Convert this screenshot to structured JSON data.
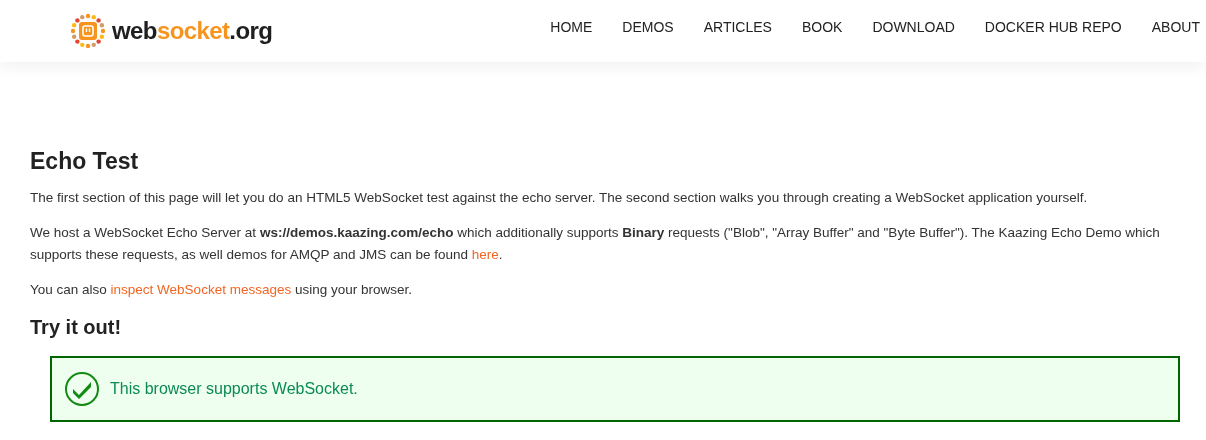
{
  "header": {
    "logo": {
      "parts": [
        {
          "text": "web",
          "accent": false
        },
        {
          "text": "socket",
          "accent": true
        },
        {
          "text": ".org",
          "accent": false
        }
      ]
    },
    "nav": [
      "HOME",
      "DEMOS",
      "ARTICLES",
      "BOOK",
      "DOWNLOAD",
      "DOCKER HUB REPO",
      "ABOUT"
    ]
  },
  "content": {
    "title": "Echo Test",
    "paragraphs": [
      [
        {
          "kind": "text",
          "text": "The first section of this page will let you do an HTML5 WebSocket test against the echo server. The second section walks you through creating a WebSocket application yourself."
        }
      ],
      [
        {
          "kind": "text",
          "text": "We host a WebSocket Echo Server at **ws://demos.kaazing.com/echo** which additionally supports **Binary** requests (\"Blob\", \"Array Buffer\" and \"Byte Buffer\"). The Kaazing Echo Demo which supports these requests, as well demos for AMQP and JMS can be found "
        },
        {
          "kind": "link",
          "text": "here"
        },
        {
          "kind": "text",
          "text": "."
        }
      ],
      [
        {
          "kind": "text",
          "text": "You can also "
        },
        {
          "kind": "link",
          "text": "inspect WebSocket messages"
        },
        {
          "kind": "text",
          "text": " using your browser."
        }
      ]
    ],
    "subtitle": "Try it out!",
    "status": {
      "supported": true,
      "message": "This browser supports WebSocket."
    }
  }
}
